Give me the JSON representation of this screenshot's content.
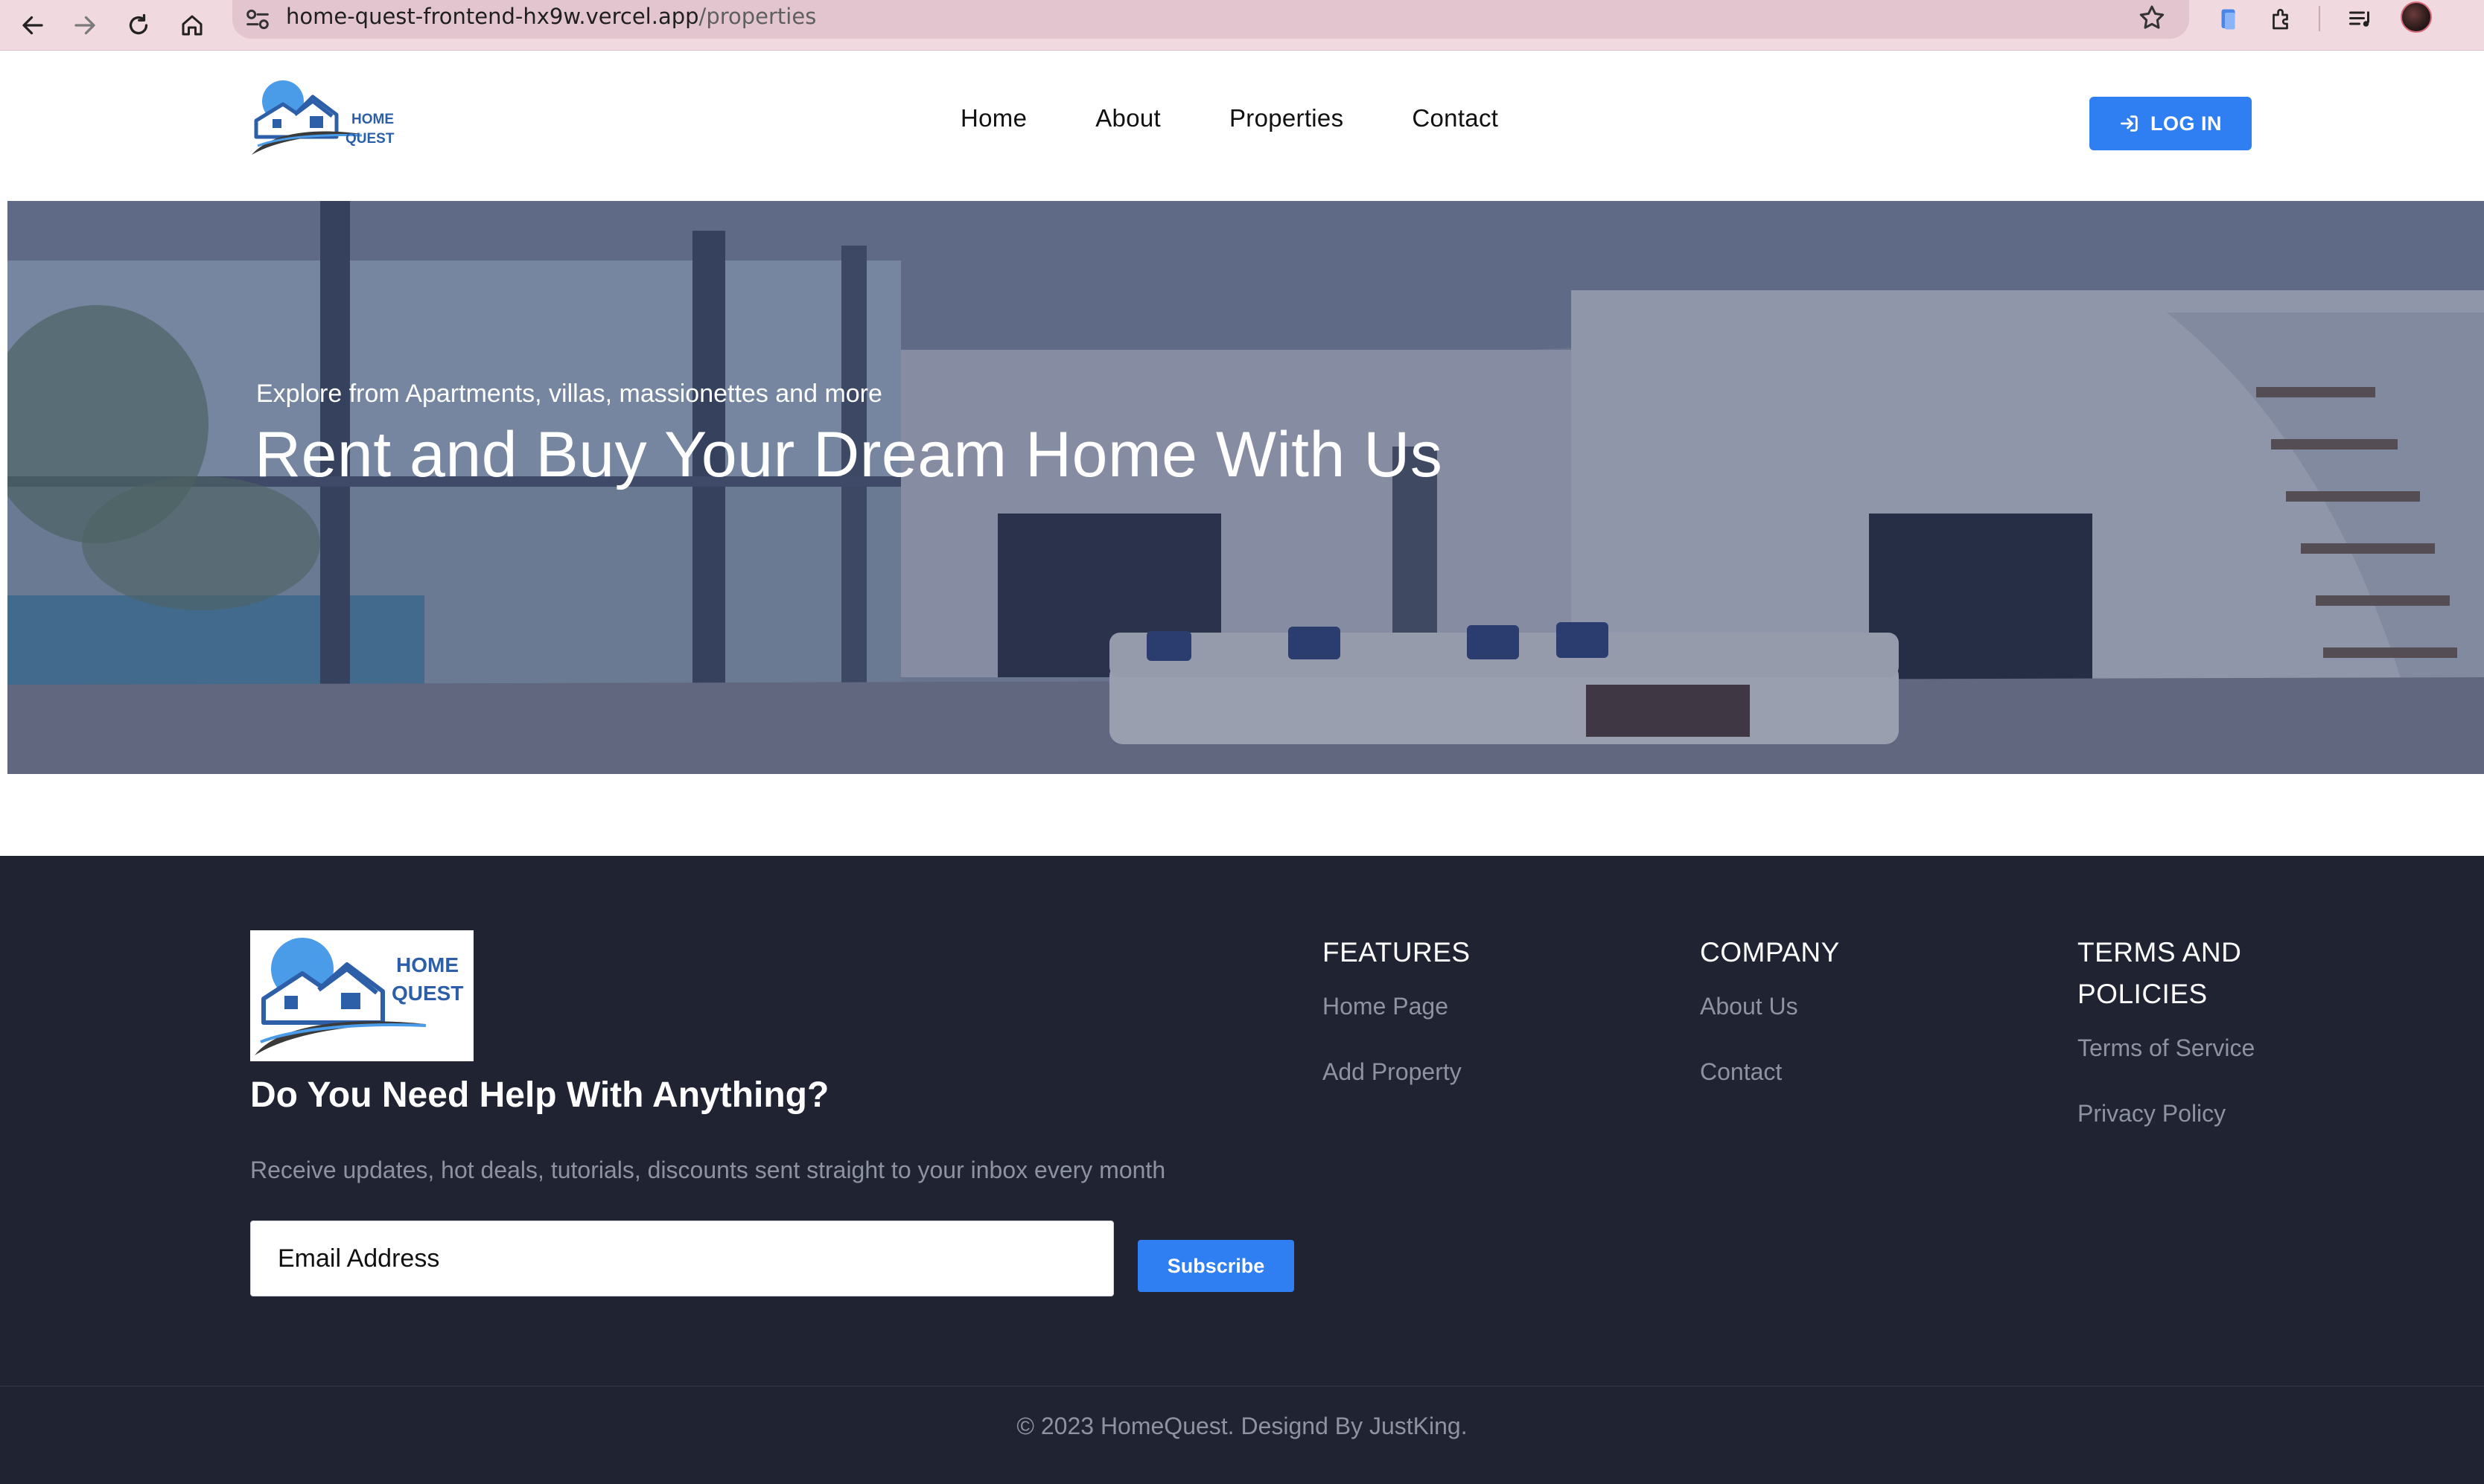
{
  "browser": {
    "url_host": "home-quest-frontend-hx9w.vercel.app",
    "url_path": "/properties"
  },
  "header": {
    "logo_text_line1": "HOME",
    "logo_text_line2": "QUEST",
    "nav": [
      {
        "label": "Home"
      },
      {
        "label": "About"
      },
      {
        "label": "Properties"
      },
      {
        "label": "Contact"
      }
    ],
    "login_label": "LOG IN"
  },
  "hero": {
    "kicker": "Explore from Apartments, villas, massionettes and more",
    "headline": "Rent and Buy Your Dream Home With Us"
  },
  "footer": {
    "logo_text_line1": "HOME",
    "logo_text_line2": "QUEST",
    "help_title": "Do You Need Help With Anything?",
    "help_desc": "Receive updates, hot deals, tutorials, discounts sent straight to your inbox every month",
    "email_placeholder": "Email Address",
    "subscribe_label": "Subscribe",
    "columns": [
      {
        "title": "FEATURES",
        "links": [
          "Home Page",
          "Add Property"
        ]
      },
      {
        "title": "COMPANY",
        "links": [
          "About Us",
          "Contact"
        ]
      },
      {
        "title": "TERMS AND POLICIES",
        "links": [
          "Terms of Service",
          "Privacy Policy"
        ]
      }
    ],
    "copyright": "© 2023 HomeQuest. Designd By JustKing."
  },
  "colors": {
    "brand_blue": "#2f7ff2",
    "footer_bg": "#1f2332",
    "chrome_bg": "#f1d9e0"
  }
}
